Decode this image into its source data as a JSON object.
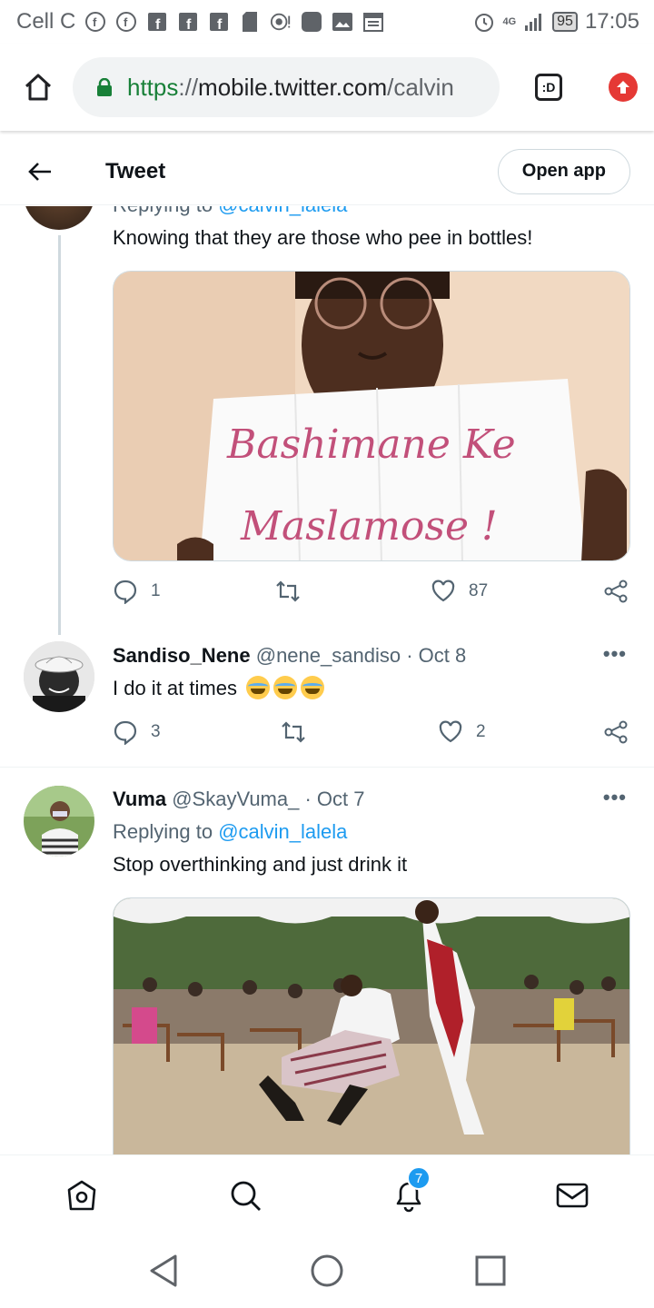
{
  "status_bar": {
    "carrier": "Cell C",
    "network": "4G",
    "battery": "95",
    "time": "17:05"
  },
  "browser": {
    "url_scheme": "https",
    "url_sep": "://",
    "url_host": "mobile.twitter.com",
    "url_path": "/calvin",
    "tab_label": ":D"
  },
  "header": {
    "title": "Tweet",
    "open_app": "Open app"
  },
  "tweets": [
    {
      "replying_label": "Replying to",
      "replying_handle": "@calvin_lalela",
      "text": "Knowing that they are those who pee in bottles!",
      "media_sign_line1": "Bashimane  Ke",
      "media_sign_line2": "Maslamose !",
      "replies": "1",
      "retweets": "",
      "likes": "87"
    },
    {
      "name": "Sandiso_Nene",
      "handle": "@nene_sandiso",
      "date": "· Oct 8",
      "text": "I do it at times",
      "replies": "3",
      "likes": "2"
    },
    {
      "name": "Vuma",
      "handle": "@SkayVuma_",
      "date": "· Oct 7",
      "replying_label": "Replying to",
      "replying_handle": "@calvin_lalela",
      "text": "Stop overthinking and just drink it"
    }
  ],
  "bottom_nav": {
    "notifications_badge": "7"
  },
  "colors": {
    "twitter_blue": "#1d9bf0",
    "secure_green": "#188038",
    "update_red": "#e53935"
  }
}
